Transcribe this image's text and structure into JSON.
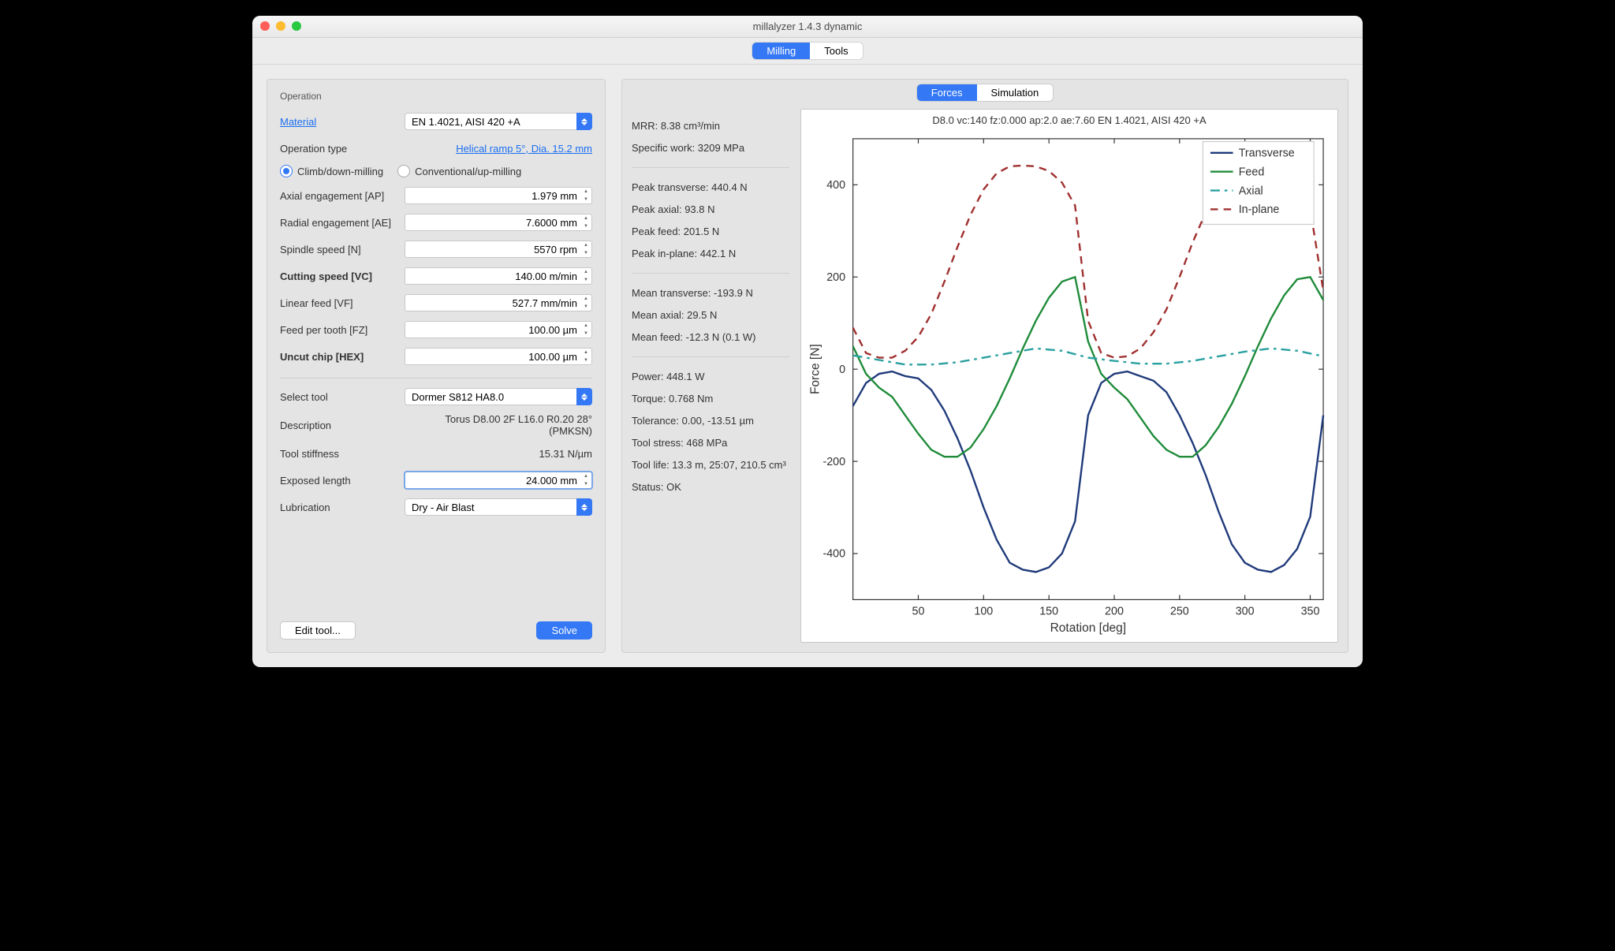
{
  "window": {
    "title": "millalyzer 1.4.3 dynamic"
  },
  "main_tabs": {
    "milling": "Milling",
    "tools": "Tools"
  },
  "sub_tabs": {
    "forces": "Forces",
    "simulation": "Simulation"
  },
  "operation": {
    "section": "Operation",
    "material_label": "Material",
    "material_value": "EN 1.4021, AISI 420 +A",
    "op_type_label": "Operation type",
    "op_type_link": "Helical ramp 5°, Dia. 15.2 mm",
    "climb_label": "Climb/down-milling",
    "conventional_label": "Conventional/up-milling",
    "ap_label": "Axial engagement [AP]",
    "ap_value": "1.979 mm",
    "ae_label": "Radial engagement [AE]",
    "ae_value": "7.6000 mm",
    "n_label": "Spindle speed [N]",
    "n_value": "5570 rpm",
    "vc_label": "Cutting speed [VC]",
    "vc_value": "140.00 m/min",
    "vf_label": "Linear feed [VF]",
    "vf_value": "527.7 mm/min",
    "fz_label": "Feed per tooth [FZ]",
    "fz_value": "100.00 µm",
    "hex_label": "Uncut chip [HEX]",
    "hex_value": "100.00 µm",
    "tool_label": "Select tool",
    "tool_value": "Dormer S812 HA8.0",
    "desc_label": "Description",
    "desc_value": "Torus D8.00 2F L16.0 R0.20 28° (PMKSN)",
    "stiffness_label": "Tool stiffness",
    "stiffness_value": "15.31 N/µm",
    "exposed_label": "Exposed length",
    "exposed_value": "24.000 mm",
    "lubrication_label": "Lubrication",
    "lubrication_value": "Dry - Air Blast",
    "edit_tool": "Edit tool...",
    "solve": "Solve"
  },
  "results": {
    "mrr": "MRR: 8.38 cm³/min",
    "specific_work": "Specific work: 3209 MPa",
    "peak_transverse": "Peak transverse: 440.4 N",
    "peak_axial": "Peak axial: 93.8 N",
    "peak_feed": "Peak feed: 201.5 N",
    "peak_inplane": "Peak in-plane: 442.1 N",
    "mean_transverse": "Mean transverse: -193.9 N",
    "mean_axial": "Mean axial: 29.5 N",
    "mean_feed": "Mean feed: -12.3 N (0.1 W)",
    "power": "Power: 448.1 W",
    "torque": "Torque: 0.768 Nm",
    "tolerance": "Tolerance: 0.00, -13.51 µm",
    "tool_stress": "Tool stress: 468 MPa",
    "tool_life": "Tool life: 13.3 m, 25:07, 210.5 cm³",
    "status": "Status: OK"
  },
  "chart_data": {
    "type": "line",
    "title": "D8.0 vc:140 fz:0.000 ap:2.0 ae:7.60 EN 1.4021, AISI 420 +A",
    "xlabel": "Rotation [deg]",
    "ylabel": "Force [N]",
    "xlim": [
      0,
      360
    ],
    "ylim": [
      -500,
      500
    ],
    "xticks": [
      50,
      100,
      150,
      200,
      250,
      300,
      350
    ],
    "yticks": [
      -400,
      -200,
      0,
      200,
      400
    ],
    "series": [
      {
        "name": "Transverse",
        "color": "#1f3a7a",
        "dash": "solid",
        "values": [
          [
            0,
            -80
          ],
          [
            10,
            -30
          ],
          [
            20,
            -10
          ],
          [
            30,
            -5
          ],
          [
            40,
            -15
          ],
          [
            50,
            -20
          ],
          [
            60,
            -45
          ],
          [
            70,
            -90
          ],
          [
            80,
            -150
          ],
          [
            90,
            -220
          ],
          [
            100,
            -300
          ],
          [
            110,
            -370
          ],
          [
            120,
            -420
          ],
          [
            130,
            -435
          ],
          [
            140,
            -440
          ],
          [
            150,
            -430
          ],
          [
            160,
            -400
          ],
          [
            170,
            -330
          ],
          [
            180,
            -100
          ],
          [
            190,
            -30
          ],
          [
            200,
            -10
          ],
          [
            210,
            -5
          ],
          [
            220,
            -15
          ],
          [
            230,
            -25
          ],
          [
            240,
            -50
          ],
          [
            250,
            -100
          ],
          [
            260,
            -160
          ],
          [
            270,
            -230
          ],
          [
            280,
            -310
          ],
          [
            290,
            -380
          ],
          [
            300,
            -420
          ],
          [
            310,
            -435
          ],
          [
            320,
            -440
          ],
          [
            330,
            -425
          ],
          [
            340,
            -390
          ],
          [
            350,
            -320
          ],
          [
            360,
            -100
          ]
        ]
      },
      {
        "name": "Feed",
        "color": "#1f8b3a",
        "dash": "solid",
        "values": [
          [
            0,
            50
          ],
          [
            10,
            -10
          ],
          [
            20,
            -40
          ],
          [
            30,
            -60
          ],
          [
            40,
            -100
          ],
          [
            50,
            -140
          ],
          [
            60,
            -175
          ],
          [
            70,
            -190
          ],
          [
            80,
            -190
          ],
          [
            90,
            -170
          ],
          [
            100,
            -130
          ],
          [
            110,
            -80
          ],
          [
            120,
            -20
          ],
          [
            130,
            45
          ],
          [
            140,
            105
          ],
          [
            150,
            155
          ],
          [
            160,
            190
          ],
          [
            170,
            200
          ],
          [
            180,
            60
          ],
          [
            190,
            -10
          ],
          [
            200,
            -40
          ],
          [
            210,
            -65
          ],
          [
            220,
            -105
          ],
          [
            230,
            -145
          ],
          [
            240,
            -175
          ],
          [
            250,
            -190
          ],
          [
            260,
            -190
          ],
          [
            270,
            -165
          ],
          [
            280,
            -125
          ],
          [
            290,
            -75
          ],
          [
            300,
            -15
          ],
          [
            310,
            50
          ],
          [
            320,
            110
          ],
          [
            330,
            160
          ],
          [
            340,
            195
          ],
          [
            350,
            200
          ],
          [
            360,
            150
          ]
        ]
      },
      {
        "name": "Axial",
        "color": "#2aa0a0",
        "dash": "dashdot",
        "values": [
          [
            0,
            30
          ],
          [
            20,
            20
          ],
          [
            40,
            10
          ],
          [
            60,
            10
          ],
          [
            80,
            15
          ],
          [
            100,
            25
          ],
          [
            120,
            35
          ],
          [
            140,
            45
          ],
          [
            160,
            40
          ],
          [
            180,
            25
          ],
          [
            200,
            18
          ],
          [
            220,
            12
          ],
          [
            240,
            12
          ],
          [
            260,
            18
          ],
          [
            280,
            28
          ],
          [
            300,
            38
          ],
          [
            320,
            45
          ],
          [
            340,
            40
          ],
          [
            360,
            28
          ]
        ]
      },
      {
        "name": "In-plane",
        "color": "#a03030",
        "dash": "dash",
        "values": [
          [
            0,
            90
          ],
          [
            10,
            35
          ],
          [
            20,
            25
          ],
          [
            30,
            25
          ],
          [
            40,
            40
          ],
          [
            50,
            70
          ],
          [
            60,
            120
          ],
          [
            70,
            190
          ],
          [
            80,
            265
          ],
          [
            90,
            335
          ],
          [
            100,
            390
          ],
          [
            110,
            425
          ],
          [
            120,
            440
          ],
          [
            130,
            442
          ],
          [
            140,
            440
          ],
          [
            150,
            430
          ],
          [
            160,
            405
          ],
          [
            170,
            355
          ],
          [
            180,
            105
          ],
          [
            190,
            35
          ],
          [
            200,
            25
          ],
          [
            210,
            28
          ],
          [
            220,
            45
          ],
          [
            230,
            80
          ],
          [
            240,
            130
          ],
          [
            250,
            200
          ],
          [
            260,
            275
          ],
          [
            270,
            340
          ],
          [
            280,
            395
          ],
          [
            290,
            428
          ],
          [
            300,
            440
          ],
          [
            310,
            442
          ],
          [
            320,
            438
          ],
          [
            330,
            425
          ],
          [
            340,
            398
          ],
          [
            350,
            348
          ],
          [
            360,
            170
          ]
        ]
      }
    ],
    "legend": [
      "Transverse",
      "Feed",
      "Axial",
      "In-plane"
    ]
  }
}
